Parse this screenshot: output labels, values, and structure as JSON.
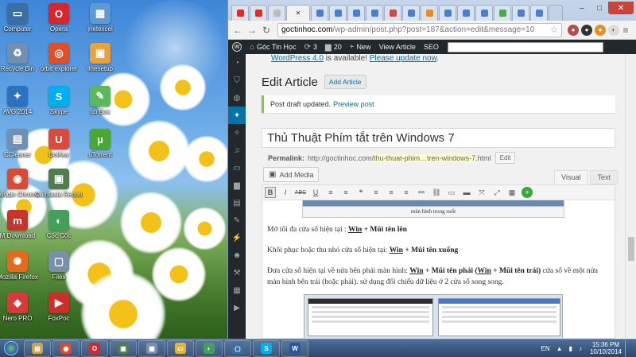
{
  "desktop": {
    "icons": [
      {
        "label": "Computer",
        "symbol": "▭",
        "color": "#3a6ea5"
      },
      {
        "label": "Opera",
        "symbol": "O",
        "color": "#d6272e"
      },
      {
        "label": "jnetexcel",
        "symbol": "▦",
        "color": "#5a9bd5"
      },
      {
        "label": "Recycle Bin",
        "symbol": "♻",
        "color": "#6f8fb5"
      },
      {
        "label": "orbit explorer",
        "symbol": "◎",
        "color": "#e04f2b"
      },
      {
        "label": "linesetup",
        "symbol": "▣",
        "color": "#e9a23b"
      },
      {
        "label": "AVG 2014",
        "symbol": "✦",
        "color": "#2d72c2"
      },
      {
        "label": "Skype",
        "symbol": "S",
        "color": "#00aff0"
      },
      {
        "label": "qb Box",
        "symbol": "✎",
        "color": "#5cb85c"
      },
      {
        "label": "CCleaner",
        "symbol": "▤",
        "color": "#6f8fb5"
      },
      {
        "label": "UniKey",
        "symbol": "U",
        "color": "#d94c3d"
      },
      {
        "label": "uTorrent",
        "symbol": "µ",
        "color": "#4aa834"
      },
      {
        "label": "Google Chrome",
        "symbol": "◉",
        "color": "#d84b34"
      },
      {
        "label": "Camtasia Recorder",
        "symbol": "▣",
        "color": "#4f7d4f"
      },
      {
        "label": "",
        "symbol": "",
        "color": ""
      },
      {
        "label": "M Download",
        "symbol": "m",
        "color": "#c7342c"
      },
      {
        "label": "Cốc Cốc",
        "symbol": "◐",
        "color": "#42a05a"
      },
      {
        "label": "",
        "symbol": "",
        "color": ""
      },
      {
        "label": "Mozilla Firefox",
        "symbol": "✺",
        "color": "#e66a1e"
      },
      {
        "label": "Files",
        "symbol": "▢",
        "color": "#7a8fa8"
      },
      {
        "label": "",
        "symbol": "",
        "color": ""
      },
      {
        "label": "Nero PRO",
        "symbol": "◆",
        "color": "#d8393a"
      },
      {
        "label": "FoxPoc",
        "symbol": "▶",
        "color": "#c9302c"
      }
    ]
  },
  "browser": {
    "tabs": [
      {
        "kind": "gmail",
        "color": "#d93025"
      },
      {
        "kind": "gmail",
        "color": "#d93025"
      },
      {
        "kind": "page",
        "color": "#bcbcbc"
      },
      {
        "kind": "active",
        "color": "#ffffff"
      },
      {
        "kind": "blue",
        "color": "#4a7fd0"
      },
      {
        "kind": "blue",
        "color": "#4a7fd0"
      },
      {
        "kind": "blue",
        "color": "#4a7fd0"
      },
      {
        "kind": "blue",
        "color": "#4a7fd0"
      },
      {
        "kind": "red",
        "color": "#d04a4a"
      },
      {
        "kind": "blue",
        "color": "#4a7fd0"
      },
      {
        "kind": "orange",
        "color": "#e3902b"
      },
      {
        "kind": "blue",
        "color": "#4a7fd0"
      },
      {
        "kind": "blue",
        "color": "#4a7fd0"
      },
      {
        "kind": "blue",
        "color": "#4a7fd0"
      },
      {
        "kind": "green",
        "color": "#4fa64f"
      },
      {
        "kind": "blue",
        "color": "#4a7fd0"
      },
      {
        "kind": "blue",
        "color": "#4a7fd0"
      }
    ],
    "address": {
      "host": "goctinhoc.com",
      "path": "/wp-admin/post.php?post=187&action=edit&message=10"
    },
    "tab_close": "✕"
  },
  "adminbar": {
    "logo": "W",
    "site_name": "Góc Tin Học",
    "updates": "3",
    "comments": "20",
    "new_label": "New",
    "view_label": "View Article",
    "seo_label": "SEO"
  },
  "wp": {
    "update_nag_text": "WordPress 4.0",
    "update_nag_mid": " is available! ",
    "update_nag_link": "Please update now",
    "update_nag_end": ".",
    "page_title": "Edit Article",
    "add_button": "Add Article",
    "notice_text": "Post draft updated.",
    "notice_link": "Preview post",
    "post_title": "Thủ Thuật Phím tắt trên Windows 7",
    "permalink_label": "Permalink:",
    "permalink_base": "http://goctinhoc.com/",
    "permalink_slug": "thu-thuat-phim…tren-windows-7",
    "permalink_ext": ".html",
    "permalink_edit": "Edit",
    "add_media": "Add Media",
    "tab_visual": "Visual",
    "tab_text": "Text",
    "toolbar_buttons": [
      "B",
      "I",
      "ABC",
      "U",
      "≡",
      "≡",
      "❝",
      "≡",
      "≡",
      "≡",
      "⚯",
      "⛓",
      "▭",
      "▬",
      "⤧",
      "⤢",
      "▦",
      "+"
    ],
    "caption": "màn hình trong suốt",
    "p1_text": "Mở tối đa cửa sổ hiện tại : ",
    "p1_k1": "Win",
    "p1_k2": " + Mũi tên lên",
    "p2_text": "Khôi phục hoặc thu nhỏ cửa sổ hiện tại: ",
    "p2_k1": "Win",
    "p2_k2": " + Mũi tên xuống",
    "p3_text": "Đưa cửa sổ hiện tại về nửa bên phải màn hình: ",
    "p3_k1": "Win",
    "p3_k2": " + Mũi tên phải (",
    "p3_k3": "Win",
    "p3_k4": " + Mũi tên trái)",
    "p3_rest": " cửa sổ về một nửa màn hình bên trái (hoặc phải). sử dụng đối chiếu dữ liệu ở 2 cửa sổ song song."
  },
  "taskbar": {
    "items": [
      {
        "symbol": "▤",
        "color": "#c9a54a"
      },
      {
        "symbol": "◉",
        "color": "#d84b34"
      },
      {
        "symbol": "O",
        "color": "#d6272e"
      },
      {
        "symbol": "▣",
        "color": "#4f7d4f"
      },
      {
        "symbol": "▦",
        "color": "#7a8fa8"
      },
      {
        "symbol": "▭",
        "color": "#e2b23a"
      },
      {
        "symbol": "◐",
        "color": "#42a05a"
      },
      {
        "symbol": "▢",
        "color": "#3a6ea5"
      },
      {
        "symbol": "S",
        "color": "#00aff0"
      },
      {
        "symbol": "W",
        "color": "#2b579a"
      }
    ],
    "lang": "EN",
    "time": "15:36 PM",
    "date": "10/10/2014"
  }
}
